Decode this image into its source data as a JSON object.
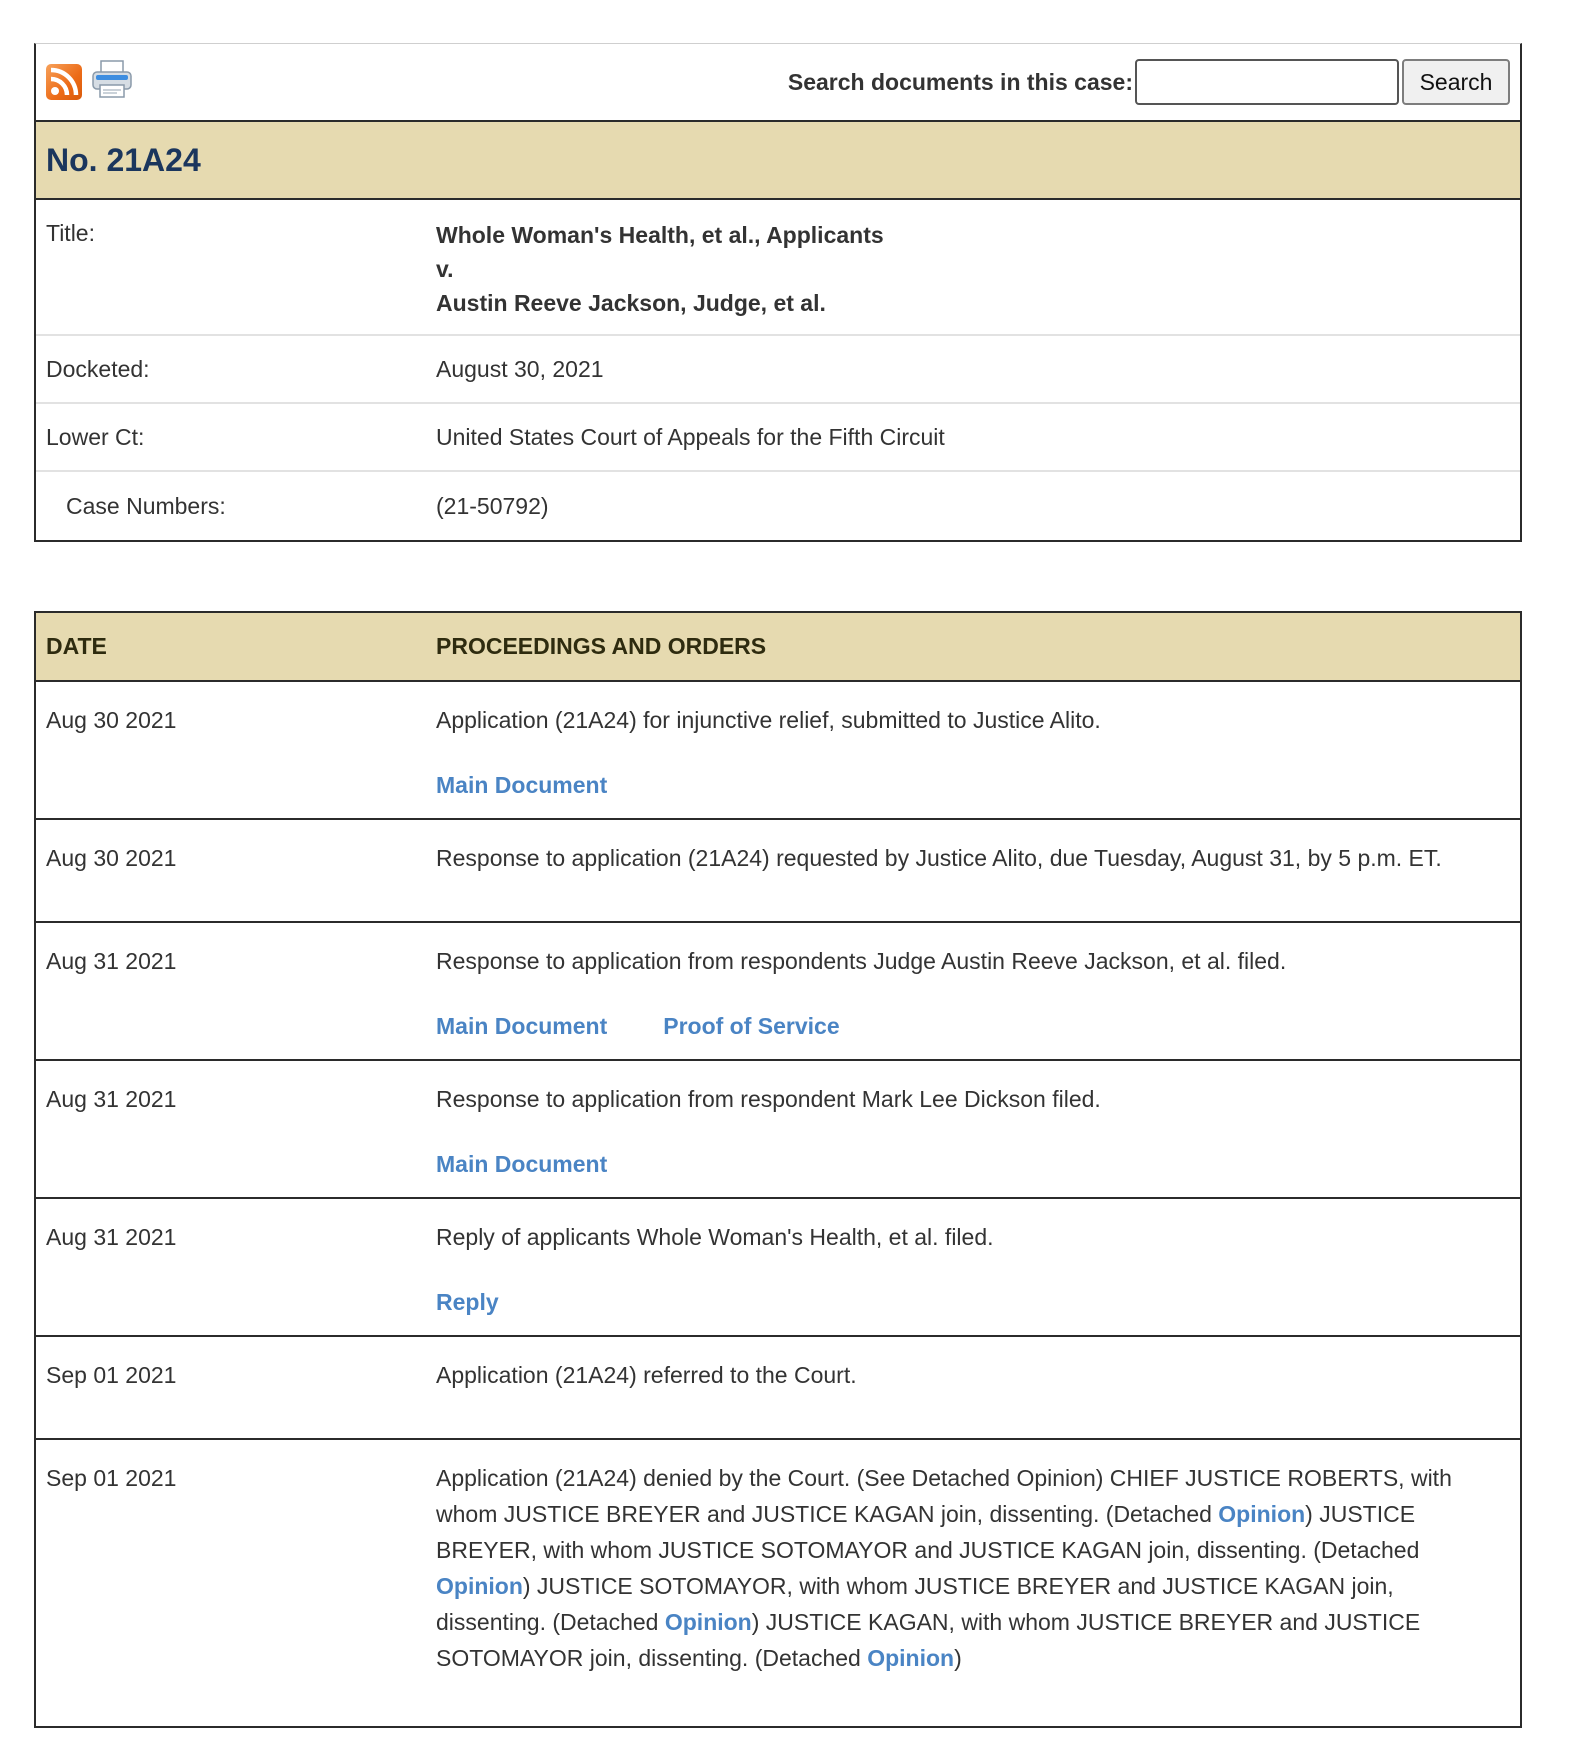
{
  "toolbar": {
    "rss_icon": "rss-feed-icon",
    "print_icon": "printer-icon",
    "search_label": "Search documents in this case:",
    "search_value": "",
    "search_button": "Search"
  },
  "case": {
    "number": "No. 21A24",
    "title_label": "Title:",
    "title_line1": "Whole Woman's Health, et al., Applicants",
    "title_line2": "v.",
    "title_line3": "Austin Reeve Jackson, Judge, et al.",
    "docketed_label": "Docketed:",
    "docketed_value": "August 30, 2021",
    "lower_ct_label": "Lower Ct:",
    "lower_ct_value": "United States Court of Appeals for the Fifth Circuit",
    "case_numbers_label": "Case Numbers:",
    "case_numbers_value": "(21-50792)"
  },
  "proceedings": {
    "date_header": "DATE",
    "text_header": "PROCEEDINGS AND ORDERS",
    "rows": [
      {
        "date": "Aug 30 2021",
        "text": "Application (21A24) for injunctive relief, submitted to Justice Alito.",
        "links": [
          "Main Document"
        ]
      },
      {
        "date": "Aug 30 2021",
        "text": "Response to application (21A24) requested by Justice Alito, due Tuesday, August 31, by 5 p.m. ET.",
        "links": []
      },
      {
        "date": "Aug 31 2021",
        "text": "Response to application from respondents Judge Austin Reeve Jackson, et al. filed.",
        "links": [
          "Main Document",
          "Proof of Service"
        ]
      },
      {
        "date": "Aug 31 2021",
        "text": "Response to application from respondent Mark Lee Dickson filed.",
        "links": [
          "Main Document"
        ]
      },
      {
        "date": "Aug 31 2021",
        "text": "Reply of applicants Whole Woman's Health, et al. filed.",
        "links": [
          "Reply"
        ]
      },
      {
        "date": "Sep 01 2021",
        "text": "Application (21A24) referred to the Court.",
        "links": []
      },
      {
        "date": "Sep 01 2021",
        "segments": [
          "Application (21A24) denied by the Court. (See Detached Opinion) CHIEF JUSTICE ROBERTS, with whom JUSTICE BREYER and JUSTICE KAGAN join, dissenting. (Detached ",
          "Opinion",
          ") JUSTICE BREYER, with whom JUSTICE SOTOMAYOR and JUSTICE KAGAN join, dissenting. (Detached ",
          "Opinion",
          ") JUSTICE SOTOMAYOR, with whom JUSTICE BREYER and JUSTICE KAGAN join, dissenting. (Detached ",
          "Opinion",
          ") JUSTICE KAGAN, with whom JUSTICE BREYER and JUSTICE SOTOMAYOR join, dissenting. (Detached ",
          "Opinion",
          ")"
        ]
      }
    ]
  }
}
